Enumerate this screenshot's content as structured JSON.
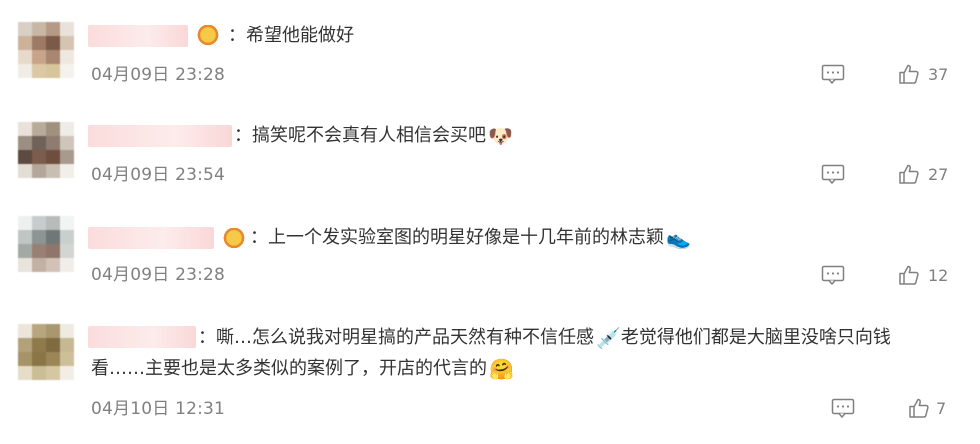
{
  "comments": [
    {
      "text_prefix": "：希望他能做好",
      "emoji": "",
      "time": "04月09日 23:28",
      "likes": "37"
    },
    {
      "text_prefix": "：搞笑呢不会真有人相信会买吧",
      "emoji": "🐶",
      "time": "04月09日 23:54",
      "likes": "27"
    },
    {
      "text_prefix": "：上一个发实验室图的明星好像是十几年前的林志颖",
      "emoji": "👟",
      "time": "04月09日 23:28",
      "likes": "12"
    },
    {
      "text_prefix": "：嘶…怎么说我对明星搞的产品天然有种不信任感",
      "emoji": "💉",
      "text_line1_suffix": "老觉得他们都是大脑里没啥只向钱",
      "text_line2": "看……主要也是太多类似的案例了，开店的代言的",
      "emoji2": "🤗",
      "time": "04月10日 12:31",
      "likes": "7"
    }
  ],
  "colors": {
    "text": "#333333",
    "muted": "#808080",
    "nick_blur": "#ec6060"
  },
  "icons": {
    "comment": "comment-icon",
    "like": "thumbs-up-icon"
  }
}
